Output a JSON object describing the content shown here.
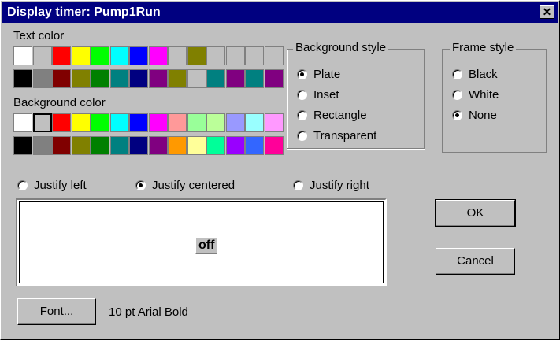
{
  "window": {
    "title": "Display timer: Pump1Run",
    "close_glyph": "✕"
  },
  "text_color": {
    "label": "Text color",
    "rows": [
      [
        "#ffffff",
        "#c0c0c0",
        "#ff0000",
        "#ffff00",
        "#00ff00",
        "#00ffff",
        "#0000ff",
        "#ff00ff",
        "#c0c0c0",
        "#808000",
        "#c0c0c0",
        "#c0c0c0",
        "#c0c0c0",
        "#c0c0c0"
      ],
      [
        "#000000",
        "#808080",
        "#800000",
        "#808000",
        "#008000",
        "#008080",
        "#000080",
        "#800080",
        "#808000",
        "#c0c0c0",
        "#008080",
        "#800080",
        "#008080",
        "#800080"
      ]
    ]
  },
  "background_color": {
    "label": "Background color",
    "selected": [
      0,
      1
    ],
    "rows": [
      [
        "#ffffff",
        "#c0c0c0",
        "#ff0000",
        "#ffff00",
        "#00ff00",
        "#00ffff",
        "#0000ff",
        "#ff00ff",
        "#ff9999",
        "#99ff99",
        "#bbff99",
        "#9999ff",
        "#99ffff",
        "#ff99ff"
      ],
      [
        "#000000",
        "#808080",
        "#800000",
        "#808000",
        "#008000",
        "#008080",
        "#000080",
        "#800080",
        "#ff9900",
        "#ffff99",
        "#00ff99",
        "#9900ff",
        "#3366ff",
        "#ff0099"
      ]
    ]
  },
  "background_style": {
    "title": "Background style",
    "options": [
      {
        "label": "Plate",
        "checked": true
      },
      {
        "label": "Inset",
        "checked": false
      },
      {
        "label": "Rectangle",
        "checked": false
      },
      {
        "label": "Transparent",
        "checked": false
      }
    ]
  },
  "frame_style": {
    "title": "Frame style",
    "options": [
      {
        "label": "Black",
        "checked": false
      },
      {
        "label": "White",
        "checked": false
      },
      {
        "label": "None",
        "checked": true
      }
    ]
  },
  "justify": {
    "left": {
      "label": "Justify left",
      "checked": false
    },
    "centered": {
      "label": "Justify centered",
      "checked": true
    },
    "right": {
      "label": "Justify right",
      "checked": false
    }
  },
  "preview": {
    "text": "off"
  },
  "buttons": {
    "ok": "OK",
    "cancel": "Cancel",
    "font": "Font..."
  },
  "font_description": "10 pt Arial Bold"
}
